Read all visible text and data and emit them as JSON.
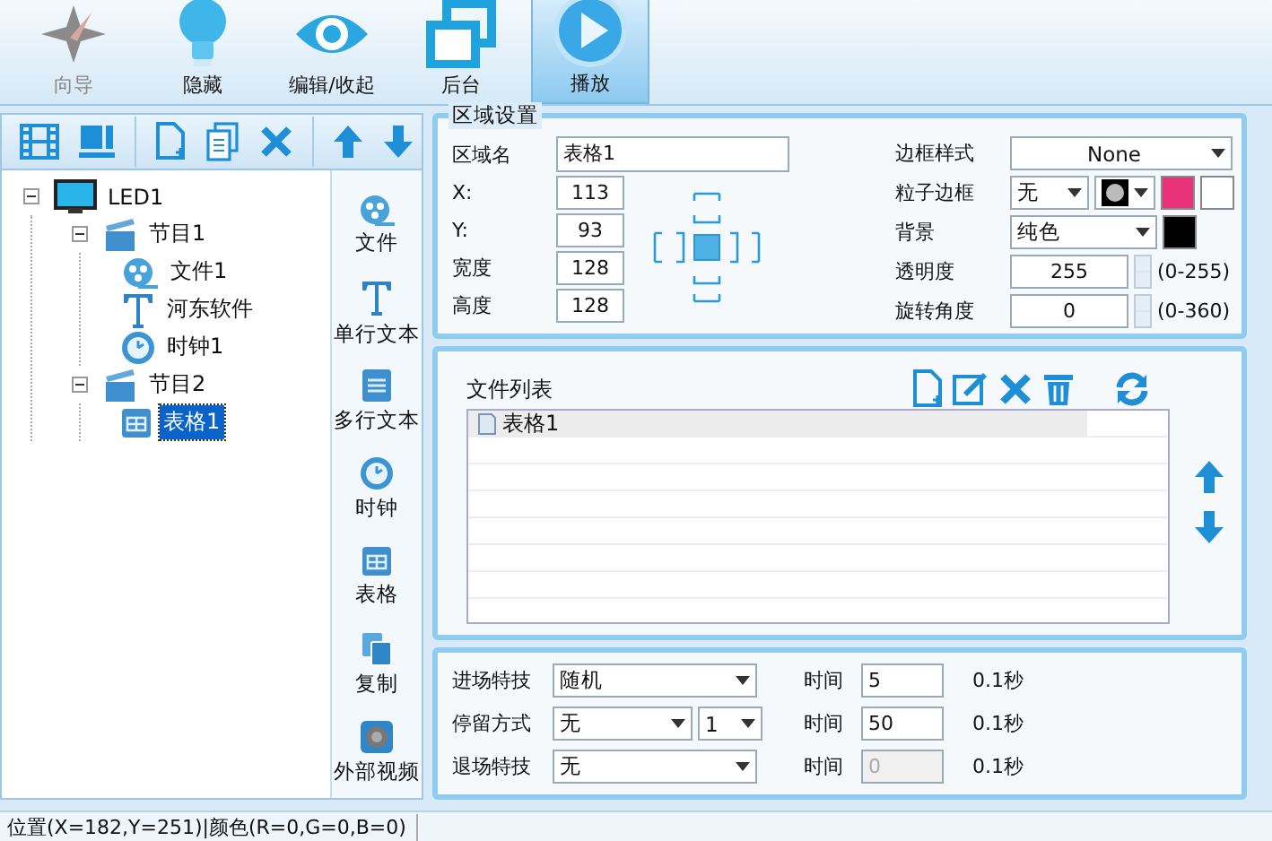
{
  "ribbon": [
    {
      "label": "向导",
      "kind": "wizard",
      "disabled": true,
      "selected": false
    },
    {
      "label": "隐藏",
      "kind": "bulb",
      "disabled": false,
      "selected": false
    },
    {
      "label": "编辑/收起",
      "kind": "eye",
      "disabled": false,
      "selected": false
    },
    {
      "label": "后台",
      "kind": "windows",
      "disabled": false,
      "selected": false
    },
    {
      "label": "播放",
      "kind": "play",
      "disabled": false,
      "selected": true
    }
  ],
  "tree": [
    {
      "label": "LED1",
      "kind": "screen",
      "expanded": true,
      "selected": false,
      "children": [
        {
          "label": "节目1",
          "kind": "program",
          "expanded": true,
          "selected": false,
          "children": [
            {
              "label": "文件1",
              "kind": "film",
              "selected": false
            },
            {
              "label": "河东软件",
              "kind": "text",
              "selected": false
            },
            {
              "label": "时钟1",
              "kind": "clock",
              "selected": false
            }
          ]
        },
        {
          "label": "节目2",
          "kind": "program",
          "expanded": true,
          "selected": false,
          "children": [
            {
              "label": "表格1",
              "kind": "table",
              "selected": true
            }
          ]
        }
      ]
    }
  ],
  "palette": [
    {
      "label": "文件",
      "kind": "film"
    },
    {
      "label": "单行文本",
      "kind": "text"
    },
    {
      "label": "多行文本",
      "kind": "doc"
    },
    {
      "label": "时钟",
      "kind": "clock"
    },
    {
      "label": "表格",
      "kind": "table"
    },
    {
      "label": "复制",
      "kind": "copy"
    },
    {
      "label": "外部视频",
      "kind": "video"
    }
  ],
  "area_settings": {
    "title": "区域设置",
    "name_label": "区域名",
    "name_value": "表格1",
    "fields": [
      {
        "label": "X:",
        "value": "113"
      },
      {
        "label": "Y:",
        "value": "93"
      },
      {
        "label": "宽度",
        "value": "128"
      },
      {
        "label": "高度",
        "value": "128"
      }
    ],
    "border_style": {
      "label": "边框样式",
      "value": "None"
    },
    "particle_border": {
      "label": "粒子边框",
      "value": "无",
      "swatches": [
        {
          "color": "#e8337a"
        },
        {
          "color": "#ffffff"
        }
      ]
    },
    "background": {
      "label": "背景",
      "value": "纯色",
      "color": "#000000"
    },
    "opacity": {
      "label": "透明度",
      "value": "255",
      "range": "(0-255)"
    },
    "rotation": {
      "label": "旋转角度",
      "value": "0",
      "range": "(0-360)"
    }
  },
  "file_list": {
    "label": "文件列表",
    "items": [
      {
        "label": "表格1",
        "selected": true
      }
    ]
  },
  "effects": [
    {
      "label": "进场特技",
      "value": "随机",
      "time_label": "时间",
      "time": "5",
      "unit": "0.1秒",
      "disabled": false
    },
    {
      "label": "停留方式",
      "value": "无",
      "extra": "1",
      "time_label": "时间",
      "time": "50",
      "unit": "0.1秒",
      "disabled": false
    },
    {
      "label": "退场特技",
      "value": "无",
      "time_label": "时间",
      "time": "0",
      "unit": "0.1秒",
      "disabled": true
    }
  ],
  "status_bar": "位置(X=182,Y=251)|颜色(R=0,G=0,B=0)"
}
